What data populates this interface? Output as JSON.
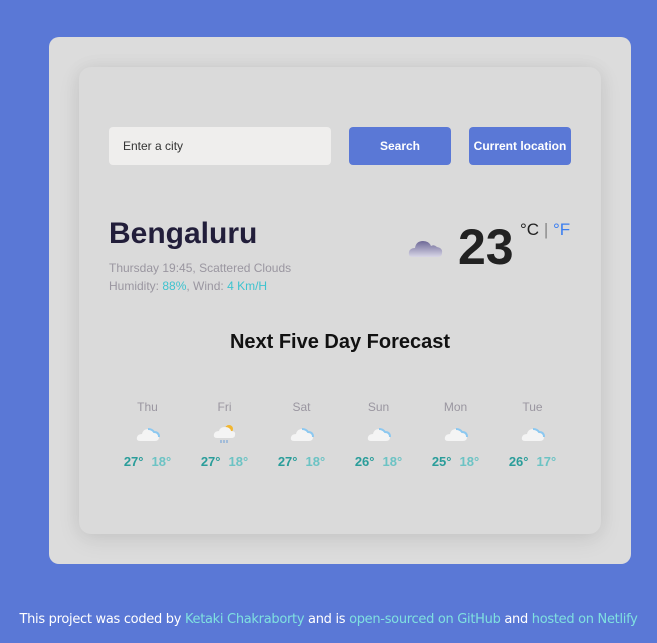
{
  "search": {
    "placeholder": "Enter a city",
    "search_label": "Search",
    "location_label": "Current location"
  },
  "current": {
    "city": "Bengaluru",
    "day_time": "Thursday 19:45",
    "description": "Scattered Clouds",
    "humidity_label": "Humidity: ",
    "humidity": "88%",
    "wind_label": ", Wind: ",
    "wind": "4 Km/H",
    "icon": "cloud-icon",
    "temperature": "23",
    "unit_c": "°C",
    "unit_sep": "|",
    "unit_f": "°F"
  },
  "forecast": {
    "title": "Next Five Day Forecast",
    "days": [
      {
        "day": "Thu",
        "icon": "cloud-icon",
        "max": "27°",
        "min": "18°"
      },
      {
        "day": "Fri",
        "icon": "sun-rain-cloud-icon",
        "max": "27°",
        "min": "18°"
      },
      {
        "day": "Sat",
        "icon": "cloud-icon",
        "max": "27°",
        "min": "18°"
      },
      {
        "day": "Sun",
        "icon": "cloud-icon",
        "max": "26°",
        "min": "18°"
      },
      {
        "day": "Mon",
        "icon": "cloud-icon",
        "max": "25°",
        "min": "18°"
      },
      {
        "day": "Tue",
        "icon": "cloud-icon",
        "max": "26°",
        "min": "17°"
      }
    ]
  },
  "footer": {
    "t1": "This project was coded by ",
    "author": "Ketaki Chakraborty",
    "t2": " and is ",
    "github": "open-sourced on GitHub",
    "t3": " and ",
    "netlify": "hosted on Netlify"
  },
  "colors": {
    "background": "#5a78d6",
    "accent": "#3ec3cf",
    "button": "#5a78d6",
    "temp_max": "#2a9d9a",
    "temp_min": "#6cc3c4"
  }
}
